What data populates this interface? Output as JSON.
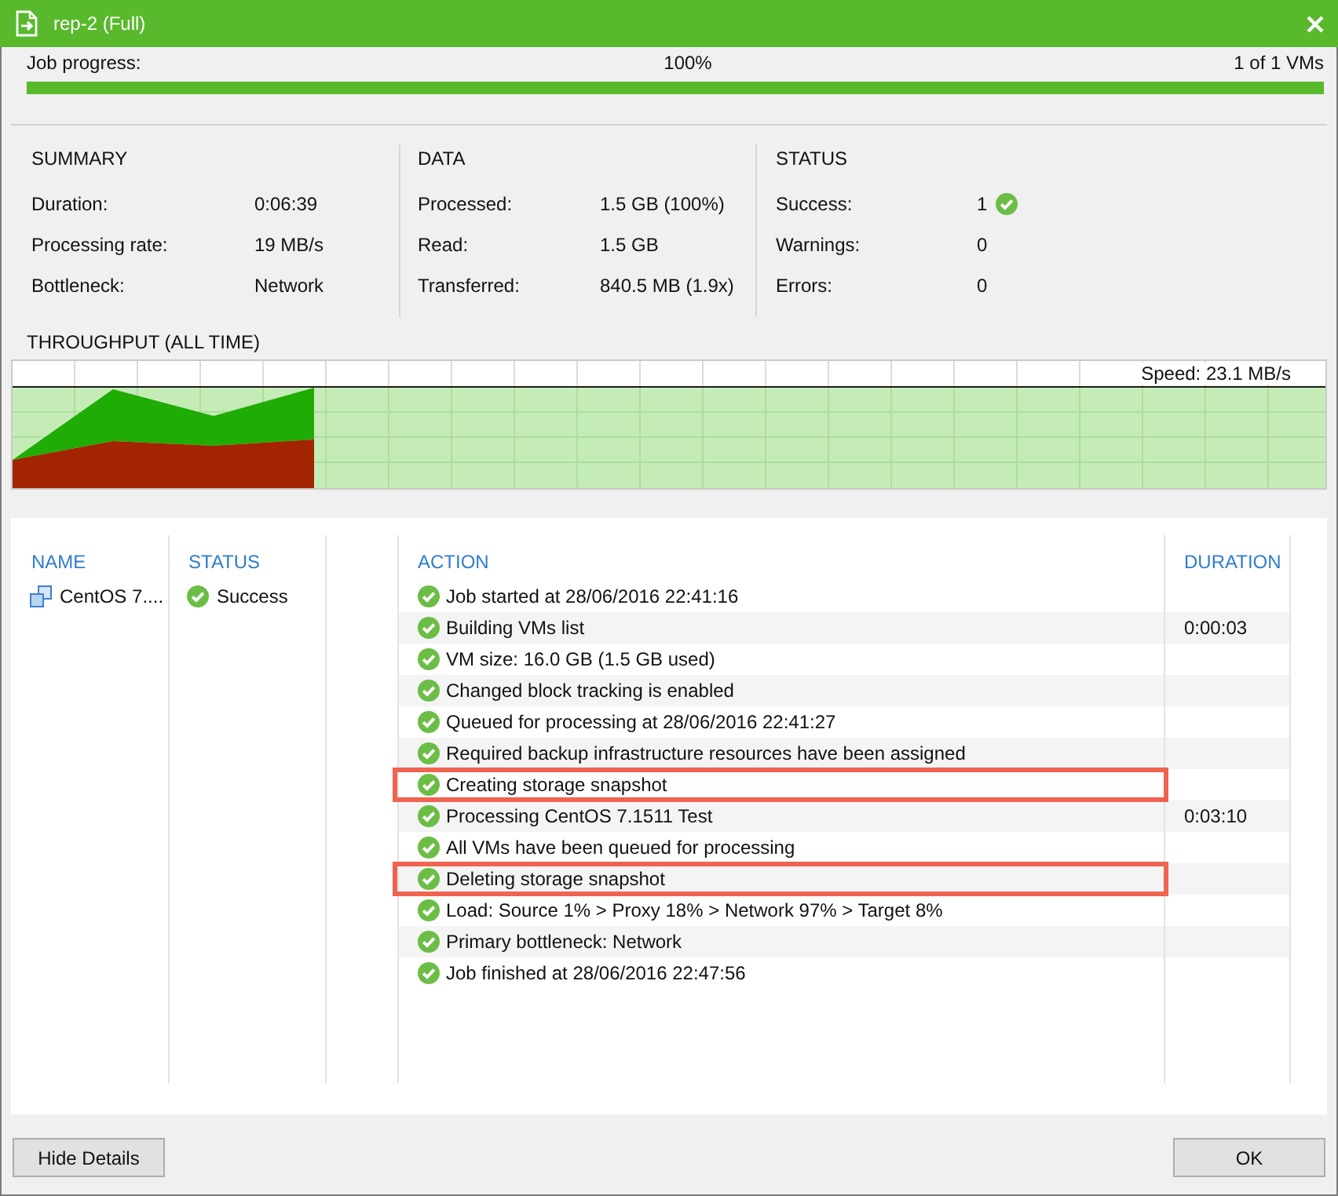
{
  "window": {
    "title": "rep-2 (Full)"
  },
  "progress": {
    "label": "Job progress:",
    "percent": "100%",
    "count": "1 of 1 VMs",
    "level": 1
  },
  "summary": [
    {
      "heading": "SUMMARY",
      "rows": [
        {
          "label": "Duration:",
          "value": "0:06:39"
        },
        {
          "label": "Processing rate:",
          "value": "19 MB/s"
        },
        {
          "label": "Bottleneck:",
          "value": "Network"
        }
      ]
    },
    {
      "heading": "DATA",
      "rows": [
        {
          "label": "Processed:",
          "value": "1.5 GB (100%)"
        },
        {
          "label": "Read:",
          "value": "1.5 GB"
        },
        {
          "label": "Transferred:",
          "value": "840.5 MB (1.9x)"
        }
      ]
    },
    {
      "heading": "STATUS",
      "rows": [
        {
          "label": "Success:",
          "value": "1",
          "kind": "success"
        },
        {
          "label": "Warnings:",
          "value": "0",
          "kind": "plain"
        },
        {
          "label": "Errors:",
          "value": "0",
          "kind": "plain"
        }
      ]
    }
  ],
  "throughput": {
    "title": "THROUGHPUT (ALL TIME)",
    "speed": "Speed: 23.1 MB/s"
  },
  "vms": {
    "columns": [
      "NAME",
      "STATUS"
    ],
    "rows": [
      {
        "name": "CentOS 7....",
        "status": "Success",
        "kind": "success"
      }
    ]
  },
  "log": {
    "columns": [
      "ACTION",
      "DURATION"
    ],
    "rows": [
      {
        "action": "Job started at 28/06/2016 22:41:16",
        "kind": "success",
        "highlighted": false
      },
      {
        "action": "Building VMs list",
        "duration": "0:00:03",
        "kind": "success",
        "highlighted": false
      },
      {
        "action": "VM size: 16.0 GB (1.5 GB used)",
        "kind": "success",
        "highlighted": false
      },
      {
        "action": "Changed block tracking is enabled",
        "kind": "success",
        "highlighted": false
      },
      {
        "action": "Queued for processing at 28/06/2016 22:41:27",
        "kind": "success",
        "highlighted": false
      },
      {
        "action": "Required backup infrastructure resources have been assigned",
        "kind": "success",
        "highlighted": false
      },
      {
        "action": "Creating storage snapshot",
        "kind": "success",
        "highlighted": true
      },
      {
        "action": "Processing CentOS 7.1511 Test",
        "duration": "0:03:10",
        "kind": "success",
        "highlighted": false
      },
      {
        "action": "All VMs have been queued for processing",
        "kind": "success",
        "highlighted": false
      },
      {
        "action": "Deleting storage snapshot",
        "kind": "success",
        "highlighted": true
      },
      {
        "action": "Load: Source 1% > Proxy 18% > Network 97% > Target 8%",
        "kind": "success",
        "highlighted": false
      },
      {
        "action": "Primary bottleneck: Network",
        "kind": "success",
        "highlighted": false
      },
      {
        "action": "Job finished at 28/06/2016 22:47:56",
        "kind": "success",
        "highlighted": false
      }
    ]
  },
  "buttons": [
    {
      "label": "Hide Details"
    },
    {
      "label": "OK"
    }
  ]
}
